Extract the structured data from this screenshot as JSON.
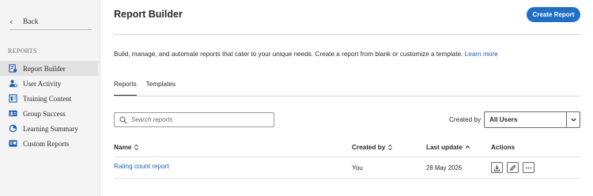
{
  "sidebar": {
    "back_label": "Back",
    "section_label": "REPORTS",
    "items": [
      {
        "label": "Report Builder",
        "icon": "report-builder-icon",
        "active": true
      },
      {
        "label": "User Activity",
        "icon": "user-activity-icon",
        "active": false
      },
      {
        "label": "Training Content",
        "icon": "training-content-icon",
        "active": false
      },
      {
        "label": "Group Success",
        "icon": "group-success-icon",
        "active": false
      },
      {
        "label": "Learning Summary",
        "icon": "learning-summary-icon",
        "active": false
      },
      {
        "label": "Custom Reports",
        "icon": "custom-reports-icon",
        "active": false
      }
    ]
  },
  "header": {
    "title": "Report Builder",
    "create_button": "Create Report"
  },
  "description": {
    "text": "Build, manage, and automate reports that cater to your unique needs. Create a report from blank or customize a template.",
    "link": "Learn more"
  },
  "tabs": [
    {
      "label": "Reports",
      "active": true
    },
    {
      "label": "Templates",
      "active": false
    }
  ],
  "search": {
    "placeholder": "Search reports",
    "value": ""
  },
  "filter": {
    "label": "Created by",
    "selected": "All Users"
  },
  "table": {
    "columns": [
      "Name",
      "Created by",
      "Last update",
      "Actions"
    ],
    "rows": [
      {
        "name": "Rating count report",
        "created_by": "You",
        "last_update": "28 May 2026"
      }
    ]
  },
  "colors": {
    "accent": "#1f6fc5",
    "link": "#1d5fb3",
    "sidebar_bg": "#f4f4f4",
    "active_item_bg": "#e1e1e1"
  }
}
